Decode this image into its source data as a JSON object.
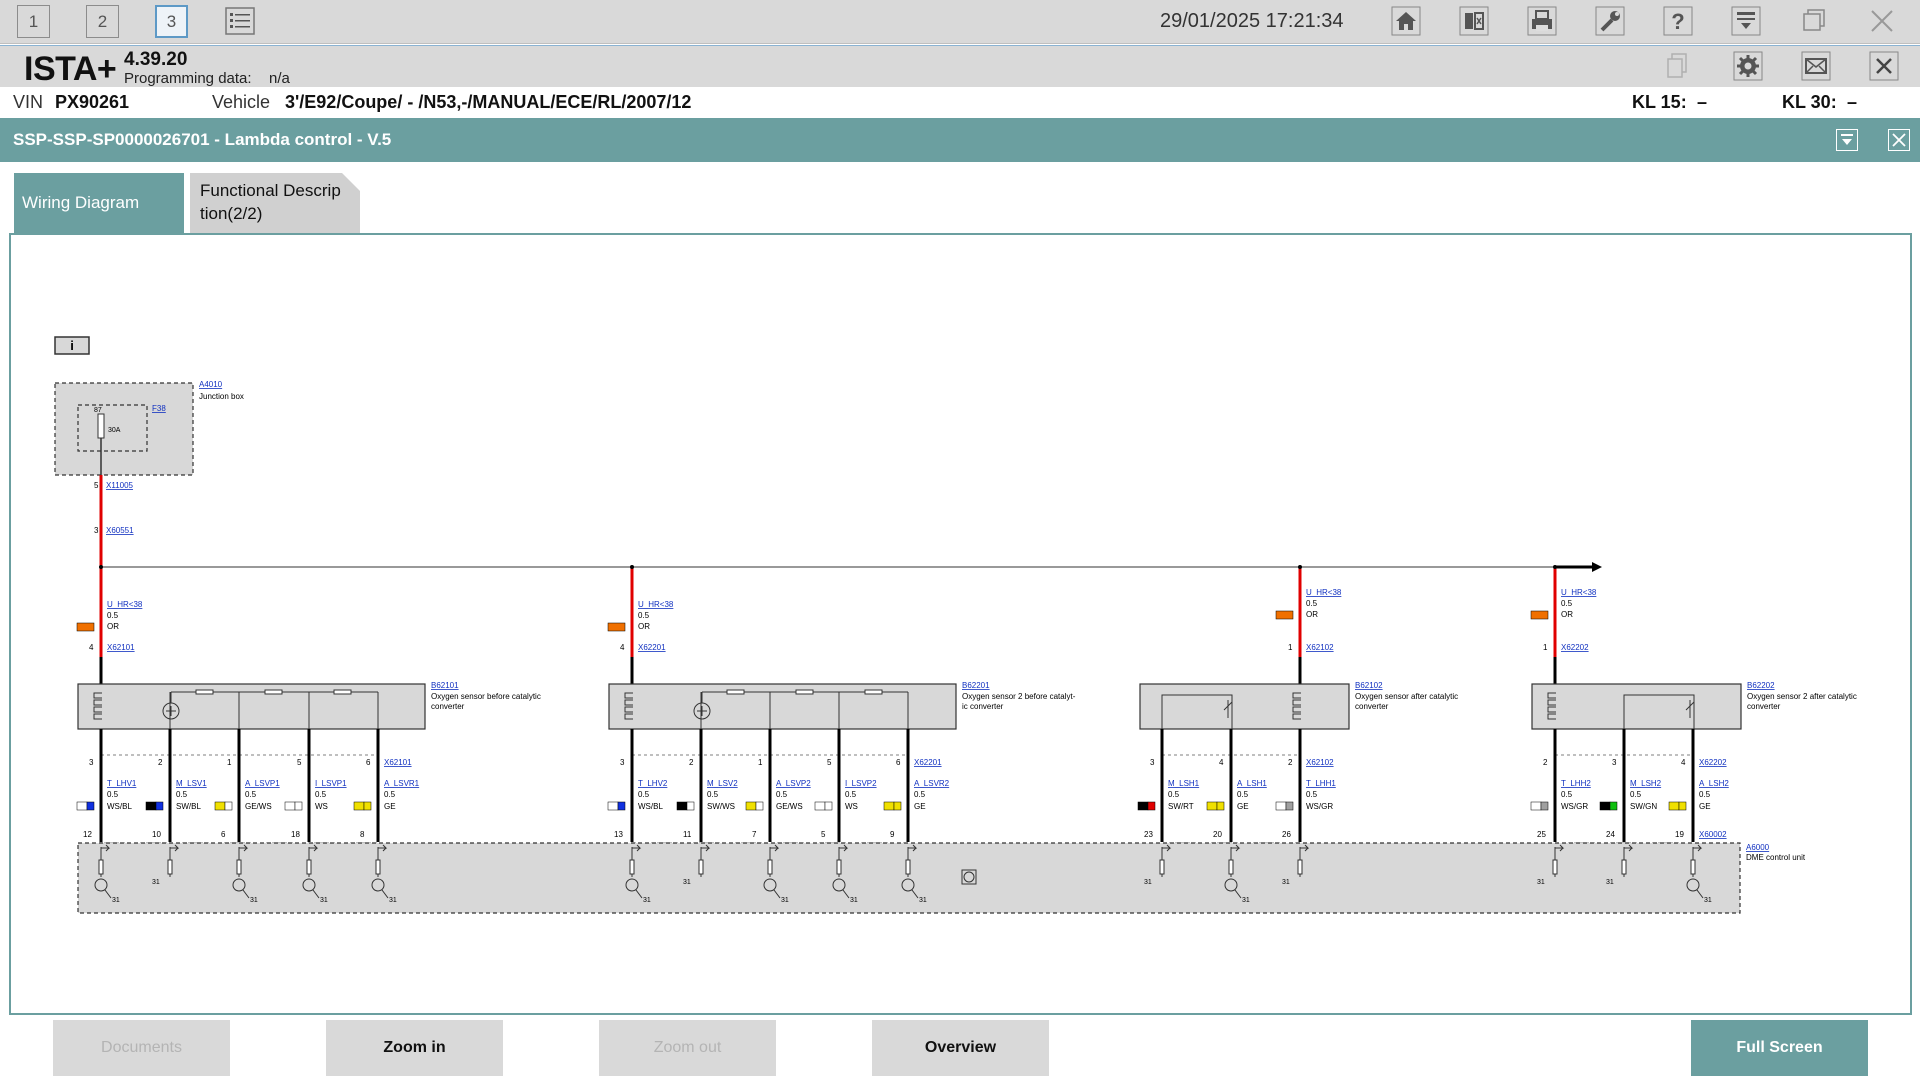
{
  "toolbar": {
    "tabs": [
      "1",
      "2",
      "3"
    ],
    "datetime": "29/01/2025 17:21:34"
  },
  "app": {
    "name": "ISTA+",
    "version": "4.39.20",
    "programming_label": "Programming data:",
    "programming_value": "n/a"
  },
  "vehicle": {
    "vin_label": "VIN",
    "vin": "PX90261",
    "vehicle_label": "Vehicle",
    "vehicle": "3'/E92/Coupe/ - /N53,-/MANUAL/ECE/RL/2007/12",
    "kl15_label": "KL 15:",
    "kl15": "–",
    "kl30_label": "KL 30:",
    "kl30": "–"
  },
  "document": {
    "title": "SSP-SSP-SP0000026701 - Lambda control - V.5"
  },
  "tabs": {
    "wiring": "Wiring Diagram",
    "functional": "Functional Description(2/2)"
  },
  "diagram": {
    "info": "i",
    "junction_box": {
      "id": "A4010",
      "name": "Junction box",
      "fuse": "F38",
      "pin": "87",
      "rating": "30A"
    },
    "feed_connectors": [
      {
        "pin": "5",
        "conn": "X11005"
      },
      {
        "pin": "3",
        "conn": "X60551"
      }
    ],
    "sensors": [
      {
        "id": "B62101",
        "name": [
          "Oxygen sensor before catalytic",
          "converter"
        ],
        "supply": {
          "signal": "U_HR<38",
          "size": "0.5",
          "color": "OR",
          "pin": "4",
          "conn": "X62101"
        },
        "wires": [
          {
            "top_pin": "3",
            "signal": "T_LHV1",
            "size": "0.5",
            "color": "WS/BL",
            "bottom_pin": "12",
            "swatch": [
              "#ffffff",
              "#1030e0"
            ]
          },
          {
            "top_pin": "2",
            "signal": "M_LSV1",
            "size": "0.5",
            "color": "SW/BL",
            "bottom_pin": "10",
            "swatch": [
              "#000000",
              "#1030e0"
            ]
          },
          {
            "top_pin": "1",
            "signal": "A_LSVP1",
            "size": "0.5",
            "color": "GE/WS",
            "bottom_pin": "6",
            "swatch": [
              "#f0e000",
              "#ffffff"
            ]
          },
          {
            "top_pin": "5",
            "signal": "I_LSVP1",
            "size": "0.5",
            "color": "WS",
            "bottom_pin": "18",
            "swatch": [
              "#ffffff",
              "#ffffff"
            ]
          },
          {
            "top_pin": "6",
            "signal": "A_LSVR1",
            "size": "0.5",
            "color": "GE",
            "bottom_pin": "8",
            "swatch": [
              "#f0e000",
              "#f0e000"
            ],
            "conn": "X62101"
          }
        ]
      },
      {
        "id": "B62201",
        "name": [
          "Oxygen sensor 2 before catalyt-",
          "ic converter"
        ],
        "supply": {
          "signal": "U_HR<38",
          "size": "0.5",
          "color": "OR",
          "pin": "4",
          "conn": "X62201"
        },
        "wires": [
          {
            "top_pin": "3",
            "signal": "T_LHV2",
            "size": "0.5",
            "color": "WS/BL",
            "bottom_pin": "13",
            "swatch": [
              "#ffffff",
              "#1030e0"
            ]
          },
          {
            "top_pin": "2",
            "signal": "M_LSV2",
            "size": "0.5",
            "color": "SW/WS",
            "bottom_pin": "11",
            "swatch": [
              "#000000",
              "#ffffff"
            ]
          },
          {
            "top_pin": "1",
            "signal": "A_LSVP2",
            "size": "0.5",
            "color": "GE/WS",
            "bottom_pin": "7",
            "swatch": [
              "#f0e000",
              "#ffffff"
            ]
          },
          {
            "top_pin": "5",
            "signal": "I_LSVP2",
            "size": "0.5",
            "color": "WS",
            "bottom_pin": "5",
            "swatch": [
              "#ffffff",
              "#ffffff"
            ]
          },
          {
            "top_pin": "6",
            "signal": "A_LSVR2",
            "size": "0.5",
            "color": "GE",
            "bottom_pin": "9",
            "swatch": [
              "#f0e000",
              "#f0e000"
            ],
            "conn": "X62201"
          }
        ]
      },
      {
        "id": "B62102",
        "name": [
          "Oxygen sensor after catalytic",
          "converter"
        ],
        "supply": {
          "signal": "U_HR<38",
          "size": "0.5",
          "color": "OR",
          "pin": "1",
          "conn": "X62102"
        },
        "wires": [
          {
            "top_pin": "3",
            "signal": "M_LSH1",
            "size": "0.5",
            "color": "SW/RT",
            "bottom_pin": "23",
            "swatch": [
              "#000000",
              "#e00000"
            ]
          },
          {
            "top_pin": "4",
            "signal": "A_LSH1",
            "size": "0.5",
            "color": "GE",
            "bottom_pin": "20",
            "swatch": [
              "#f0e000",
              "#f0e000"
            ]
          },
          {
            "top_pin": "2",
            "signal": "T_LHH1",
            "size": "0.5",
            "color": "WS/GR",
            "bottom_pin": "26",
            "swatch": [
              "#ffffff",
              "#a0a0a0"
            ],
            "conn": "X62102"
          }
        ]
      },
      {
        "id": "B62202",
        "name": [
          "Oxygen sensor 2 after catalytic",
          "converter"
        ],
        "supply": {
          "signal": "U_HR<38",
          "size": "0.5",
          "color": "OR",
          "pin": "1",
          "conn": "X62202"
        },
        "wires": [
          {
            "top_pin": "2",
            "signal": "T_LHH2",
            "size": "0.5",
            "color": "WS/GR",
            "bottom_pin": "25",
            "swatch": [
              "#ffffff",
              "#a0a0a0"
            ]
          },
          {
            "top_pin": "3",
            "signal": "M_LSH2",
            "size": "0.5",
            "color": "SW/GN",
            "bottom_pin": "24",
            "swatch": [
              "#000000",
              "#10c010"
            ]
          },
          {
            "top_pin": "4",
            "signal": "A_LSH2",
            "size": "0.5",
            "color": "GE",
            "bottom_pin": "19",
            "swatch": [
              "#f0e000",
              "#f0e000"
            ],
            "conn": "X62202"
          }
        ]
      }
    ],
    "dme": {
      "id": "A6000",
      "name": "DME control unit",
      "conn": "X60002",
      "ground": "31"
    }
  },
  "buttons": {
    "documents": "Documents",
    "zoom_in": "Zoom in",
    "zoom_out": "Zoom out",
    "overview": "Overview",
    "full_screen": "Full Screen"
  },
  "colors": {
    "accent": "#6b9fa0",
    "supply_wire": "#e00000",
    "orange_wire": "#f07000"
  }
}
